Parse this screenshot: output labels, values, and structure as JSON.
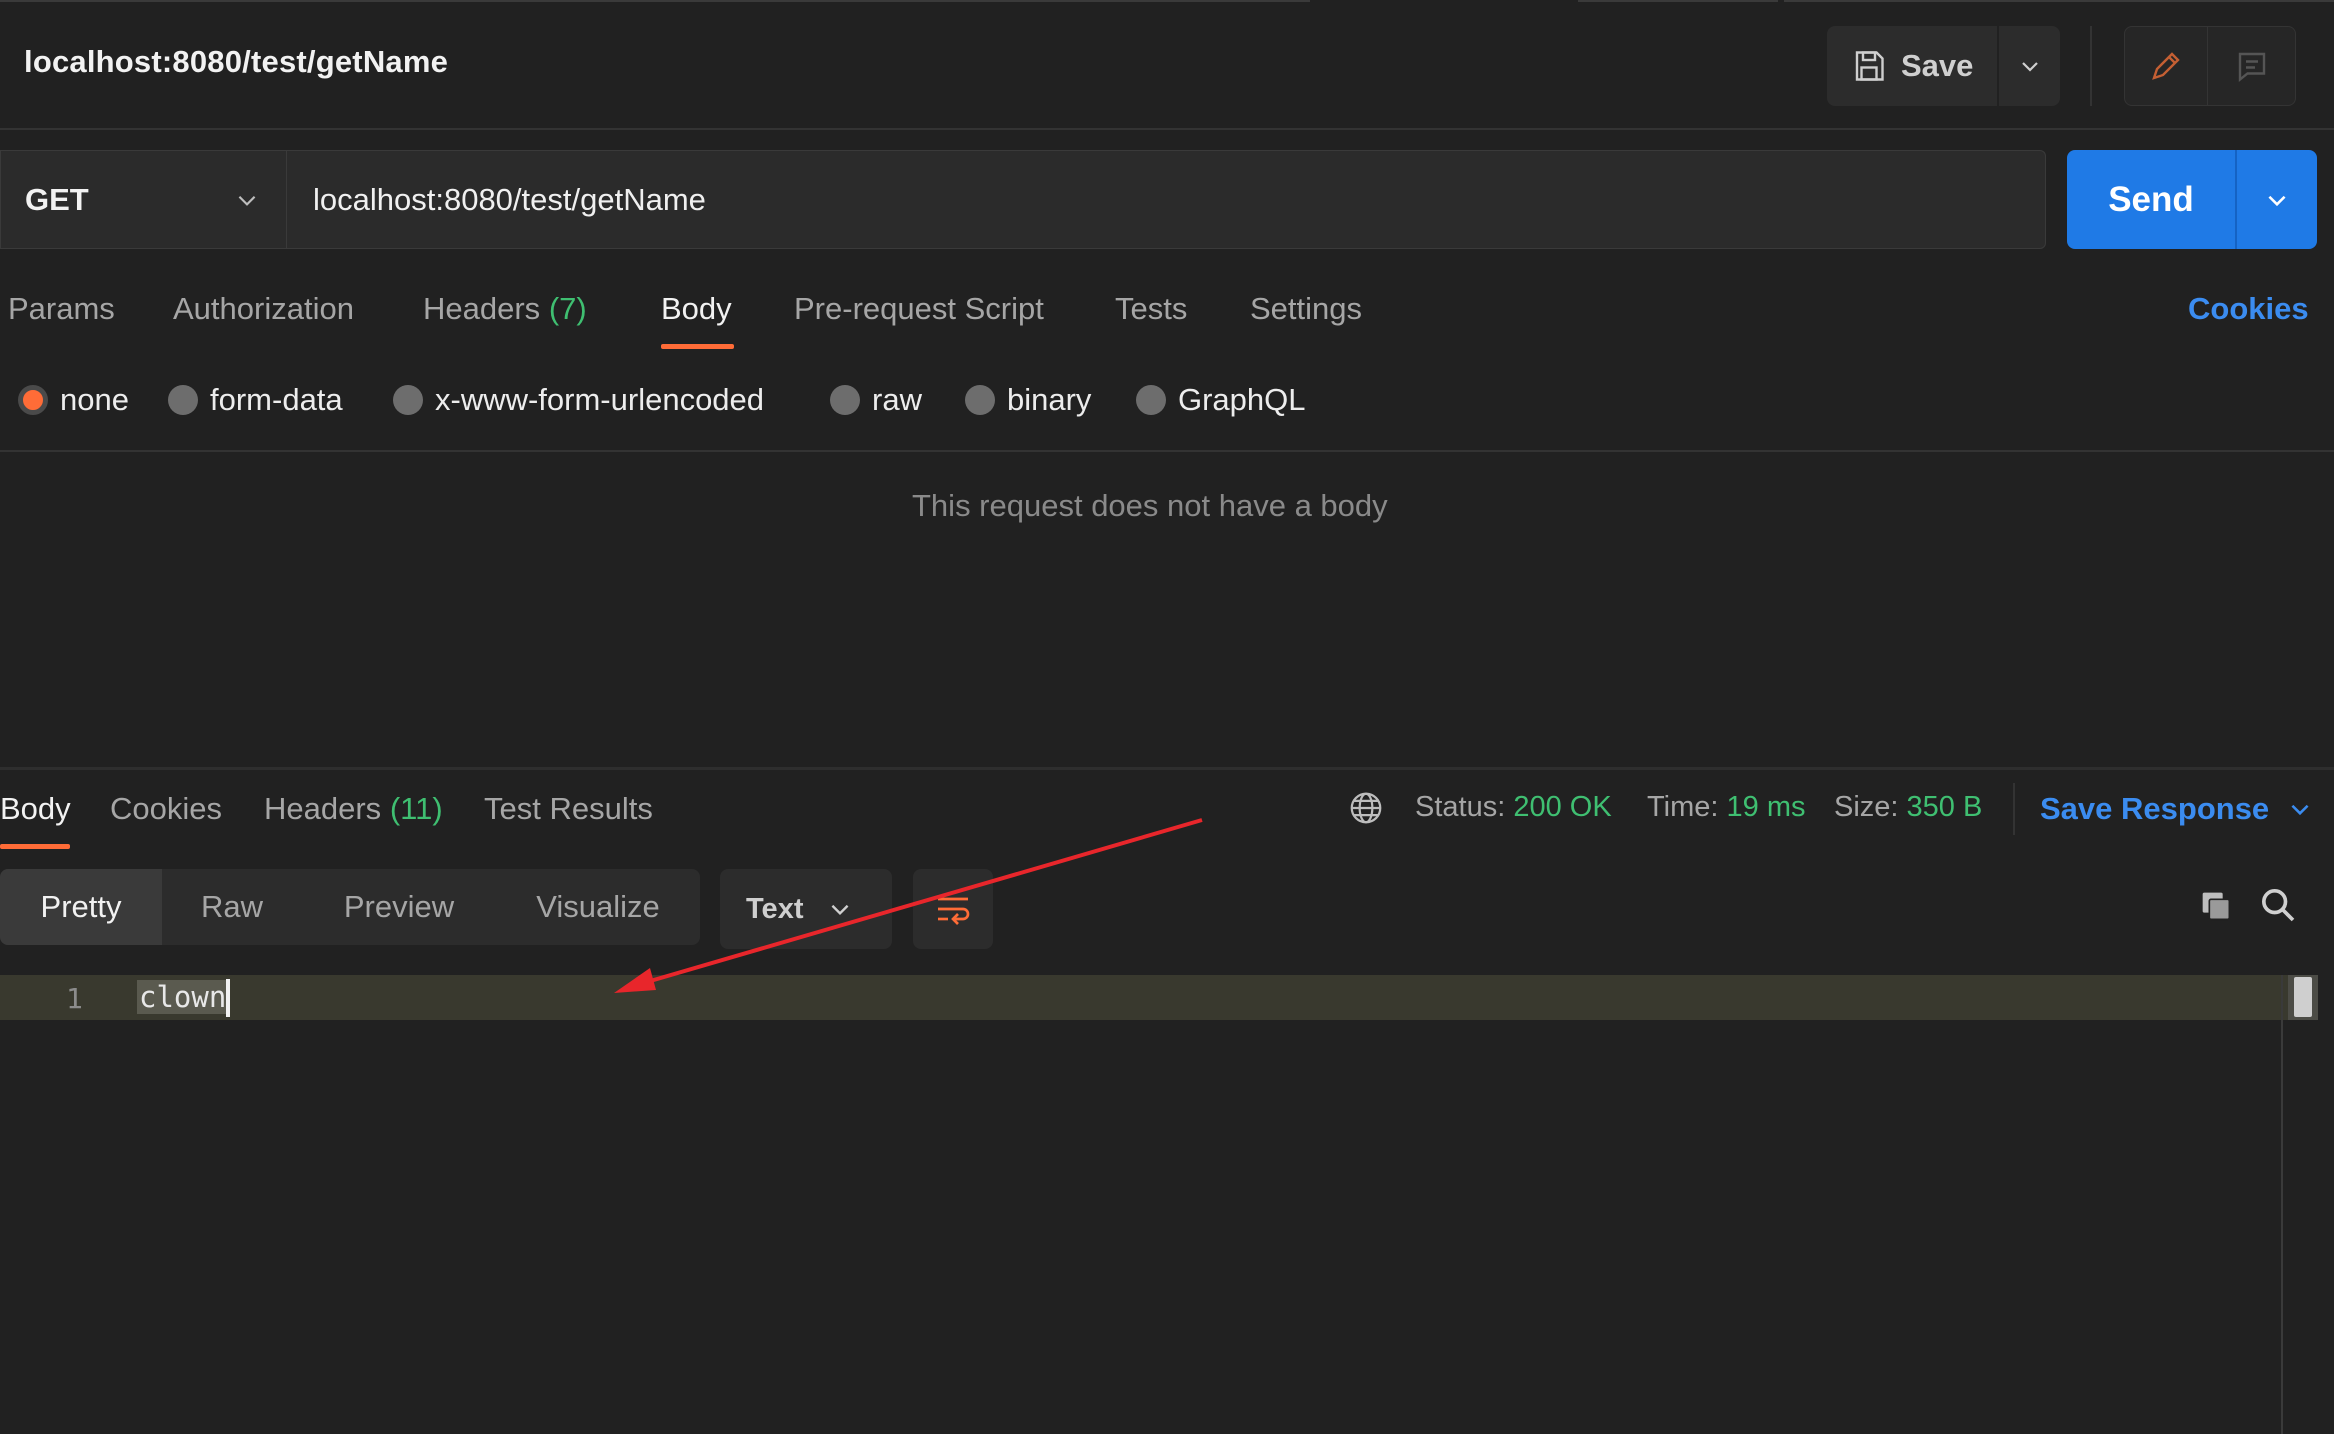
{
  "request": {
    "title": "localhost:8080/test/getName",
    "save_label": "Save",
    "method": "GET",
    "url": "localhost:8080/test/getName",
    "send_label": "Send"
  },
  "request_tabs": {
    "params": "Params",
    "authorization": "Authorization",
    "headers": "Headers",
    "headers_count": "(7)",
    "body": "Body",
    "prerequest": "Pre-request Script",
    "tests": "Tests",
    "settings": "Settings",
    "cookies": "Cookies"
  },
  "body_types": {
    "none": "none",
    "form_data": "form-data",
    "urlencoded": "x-www-form-urlencoded",
    "raw": "raw",
    "binary": "binary",
    "graphql": "GraphQL",
    "selected": "none"
  },
  "body_empty_message": "This request does not have a body",
  "response_tabs": {
    "body": "Body",
    "cookies": "Cookies",
    "headers": "Headers",
    "headers_count": "(11)",
    "test_results": "Test Results"
  },
  "response_meta": {
    "status_label": "Status:",
    "status_value": "200 OK",
    "time_label": "Time:",
    "time_value": "19 ms",
    "size_label": "Size:",
    "size_value": "350 B",
    "save_response": "Save Response"
  },
  "format_tabs": {
    "pretty": "Pretty",
    "raw": "Raw",
    "preview": "Preview",
    "visualize": "Visualize",
    "type": "Text"
  },
  "response_body": {
    "line_number": "1",
    "content": "clown"
  },
  "colors": {
    "background": "#212121",
    "accent_orange": "#ff6c37",
    "send_blue": "#1f7ae6",
    "link_blue": "#3b8cf0",
    "success_green": "#3fbf71",
    "annotation_red": "#e8262b"
  }
}
